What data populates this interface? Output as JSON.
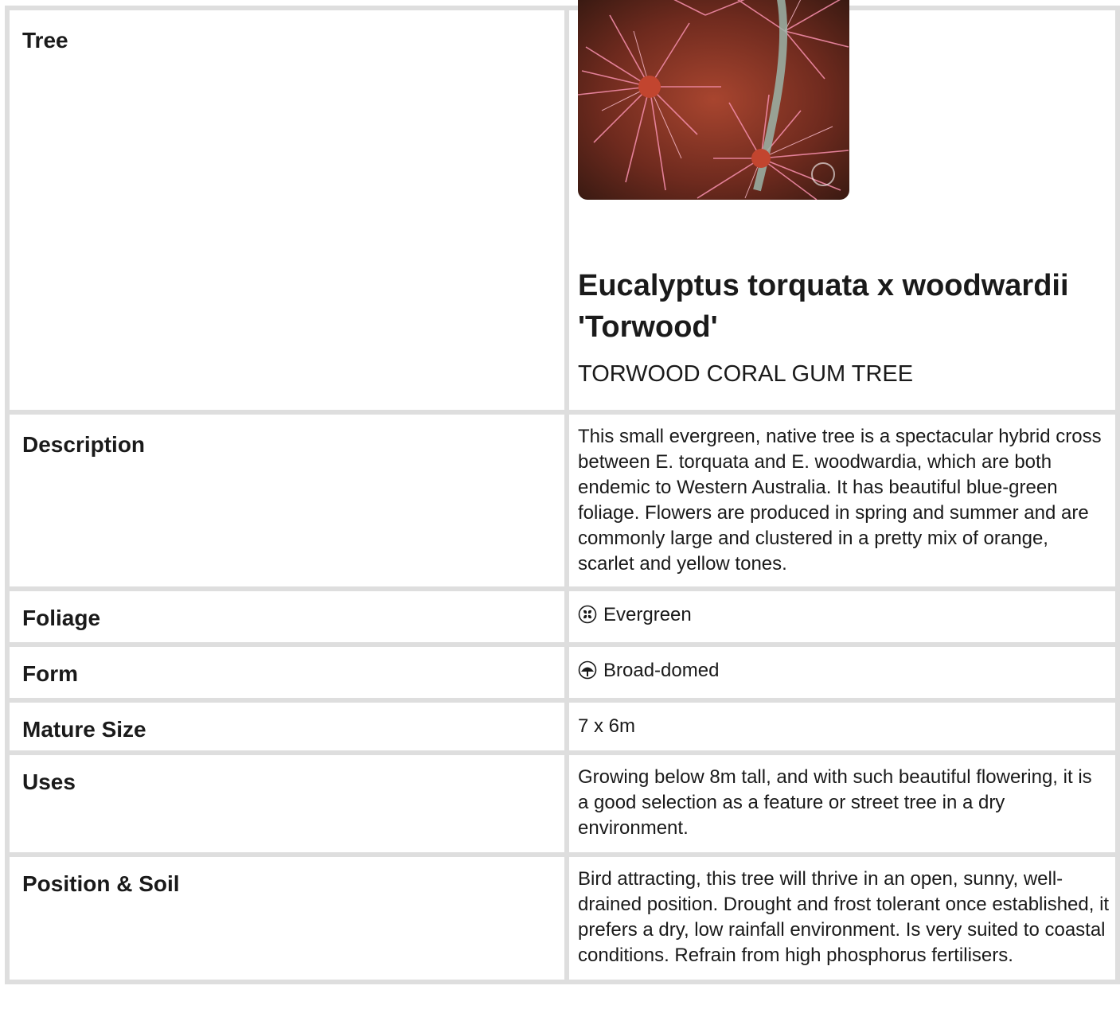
{
  "header": {
    "label": "Tree"
  },
  "plant": {
    "botanical_name": "Eucalyptus torquata x woodwardii 'Torwood'",
    "common_name": "TORWOOD CORAL GUM TREE"
  },
  "rows": {
    "description": {
      "label": "Description",
      "value": "This small evergreen, native tree is a spectacular hybrid cross between E. torquata and E. woodwardia, which are both endemic to Western Australia. It has beautiful blue-green foliage. Flowers are produced in spring and summer and are commonly large and clustered in a pretty mix of orange, scarlet and yellow tones."
    },
    "foliage": {
      "label": "Foliage",
      "value": "Evergreen",
      "icon": "evergreen-icon"
    },
    "form": {
      "label": "Form",
      "value": "Broad-domed",
      "icon": "broad-domed-icon"
    },
    "mature_size": {
      "label": "Mature Size",
      "value": "7 x 6m"
    },
    "uses": {
      "label": "Uses",
      "value": "Growing below 8m tall, and with such beautiful flowering, it is a good selection as a feature or street tree in a dry environment."
    },
    "position_soil": {
      "label": "Position & Soil",
      "value": "Bird attracting, this tree will thrive in an open, sunny, well-drained position. Drought and frost tolerant once established, it prefers a dry, low rainfall environment. Is very suited to coastal conditions. Refrain from high phosphorus fertilisers."
    }
  },
  "colors": {
    "grid": "#dedede",
    "text": "#1a1a1a",
    "flower_pink": "#e8708f"
  }
}
